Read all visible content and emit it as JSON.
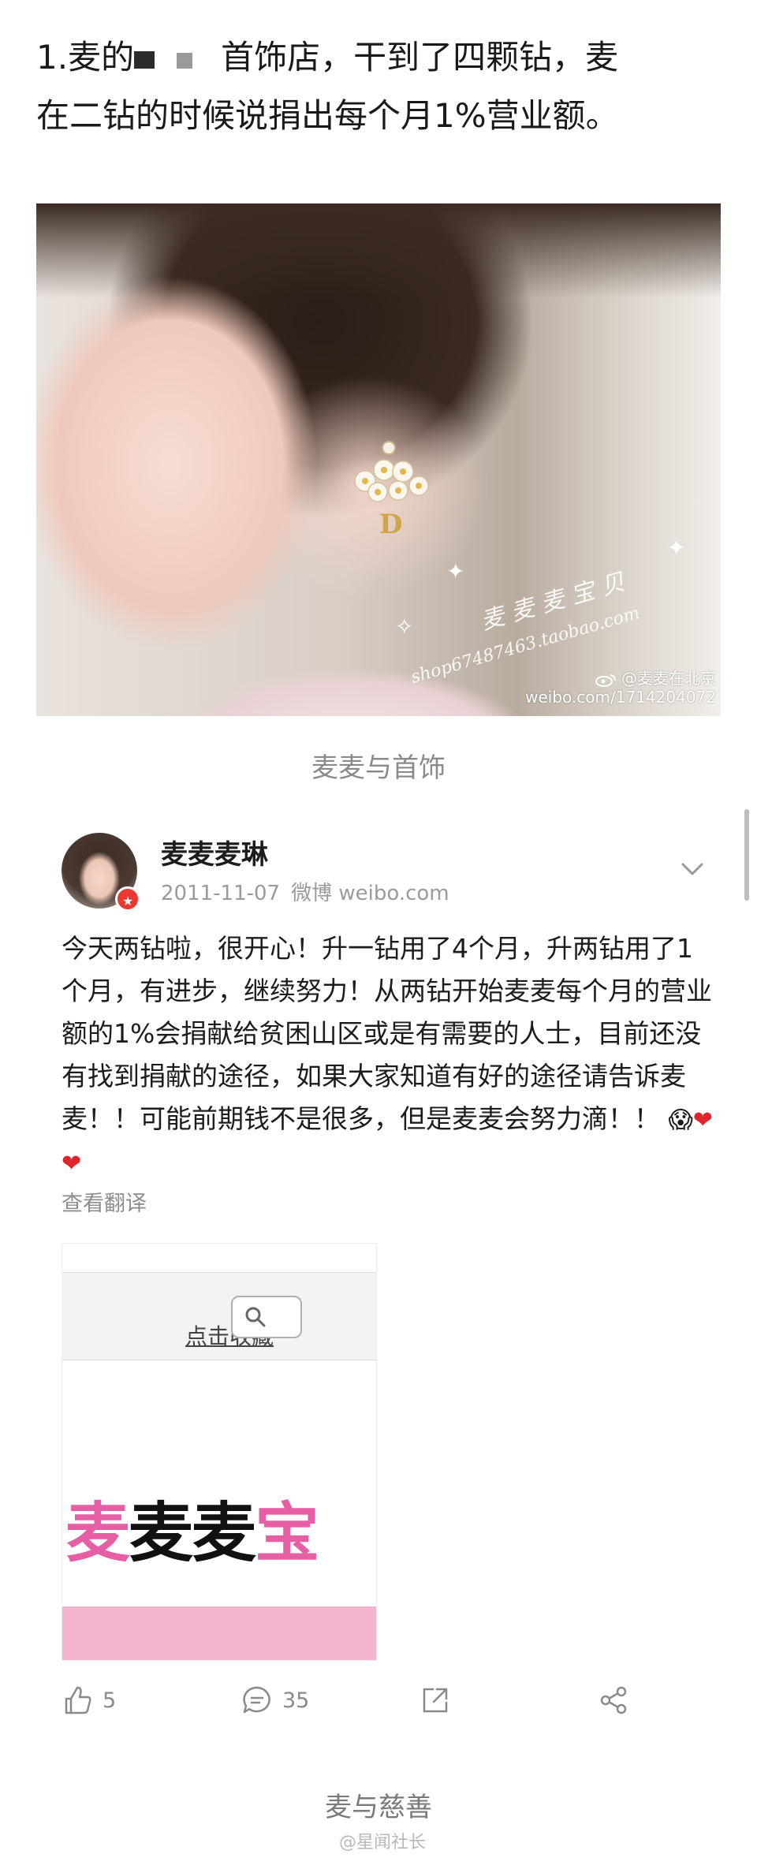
{
  "intro": {
    "line1_prefix": "1.麦的",
    "line1_suffix": "首饰店，干到了四颗钻，麦",
    "line2": "在二钻的时候说捐出每个月1%营业额。"
  },
  "photo": {
    "shop_name": "麦 麦 麦 宝 贝",
    "shop_url": "shop67487463.taobao.com",
    "weibo_handle": "@麦麦在北京",
    "weibo_url": "weibo.com/1714204072"
  },
  "caption1": "麦麦与首饰",
  "post": {
    "username": "麦麦麦琳",
    "date": "2011-11-07",
    "source": "微博 weibo.com",
    "text": "今天两钻啦，很开心！升一钻用了4个月，升两钻用了1个月，有进步，继续努力！从两钻开始麦麦每个月的营业额的1%会捐献给贫困山区或是有需要的人士，目前还没有找到捐献的途径，如果大家知道有好的途径请告诉麦麦！！可能前期钱不是很多，但是麦麦会努力滴！！",
    "emojis": [
      "😱",
      "❤",
      "❤"
    ],
    "translate": "查看翻译",
    "attachment": {
      "favorite_link": "点击收藏",
      "brand_chars": [
        "麦",
        "麦",
        "麦",
        "宝"
      ]
    },
    "actions": {
      "likes": "5",
      "comments": "35"
    }
  },
  "caption2": "麦与慈善",
  "watermark": "@星闻社长",
  "colors": {
    "heart": "#e0262c",
    "brand_pink": "#e65fa4",
    "verified_badge": "#e8382f"
  }
}
